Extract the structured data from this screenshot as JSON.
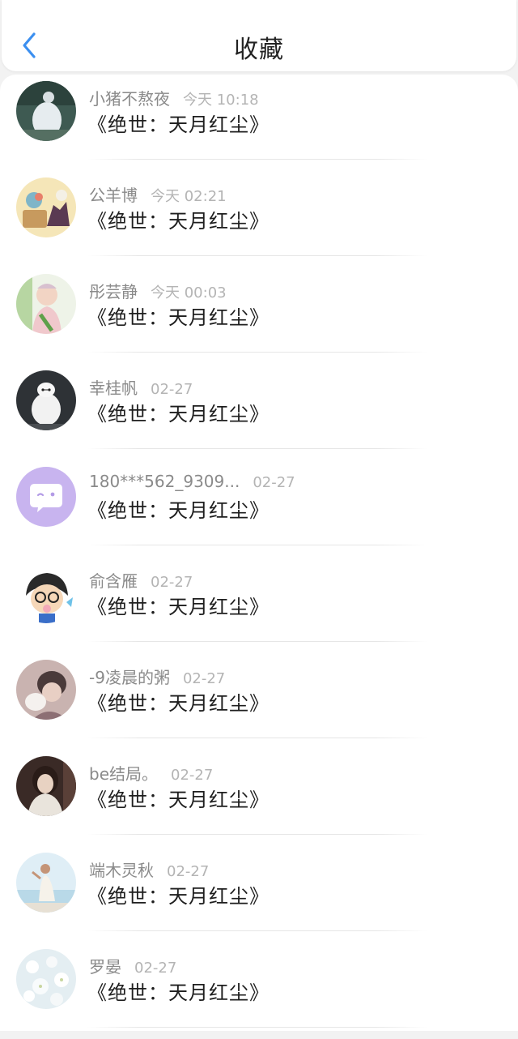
{
  "header": {
    "title": "收藏",
    "back_icon": "chevron-left-icon",
    "accent_color": "#3b8ff0"
  },
  "favorites": [
    {
      "username": "小猪不熬夜",
      "time": "今天 10:18",
      "work": "《绝世：天月红尘》",
      "avatar": "avatar-1"
    },
    {
      "username": "公羊博",
      "time": "今天 02:21",
      "work": "《绝世：天月红尘》",
      "avatar": "avatar-2"
    },
    {
      "username": "彤芸静",
      "time": "今天 00:03",
      "work": "《绝世：天月红尘》",
      "avatar": "avatar-3"
    },
    {
      "username": "幸桂帆",
      "time": "02-27",
      "work": "《绝世：天月红尘》",
      "avatar": "avatar-4"
    },
    {
      "username": "180***562_9309...",
      "time": "02-27",
      "work": "《绝世：天月红尘》",
      "avatar": "avatar-5"
    },
    {
      "username": "俞含雁",
      "time": "02-27",
      "work": "《绝世：天月红尘》",
      "avatar": "avatar-6"
    },
    {
      "username": "-9凌晨的粥",
      "time": "02-27",
      "work": "《绝世：天月红尘》",
      "avatar": "avatar-7"
    },
    {
      "username": "be结局。",
      "time": "02-27",
      "work": "《绝世：天月红尘》",
      "avatar": "avatar-8"
    },
    {
      "username": "端木灵秋",
      "time": "02-27",
      "work": "《绝世：天月红尘》",
      "avatar": "avatar-9"
    },
    {
      "username": "罗晏",
      "time": "02-27",
      "work": "《绝世：天月红尘》",
      "avatar": "avatar-10"
    }
  ]
}
